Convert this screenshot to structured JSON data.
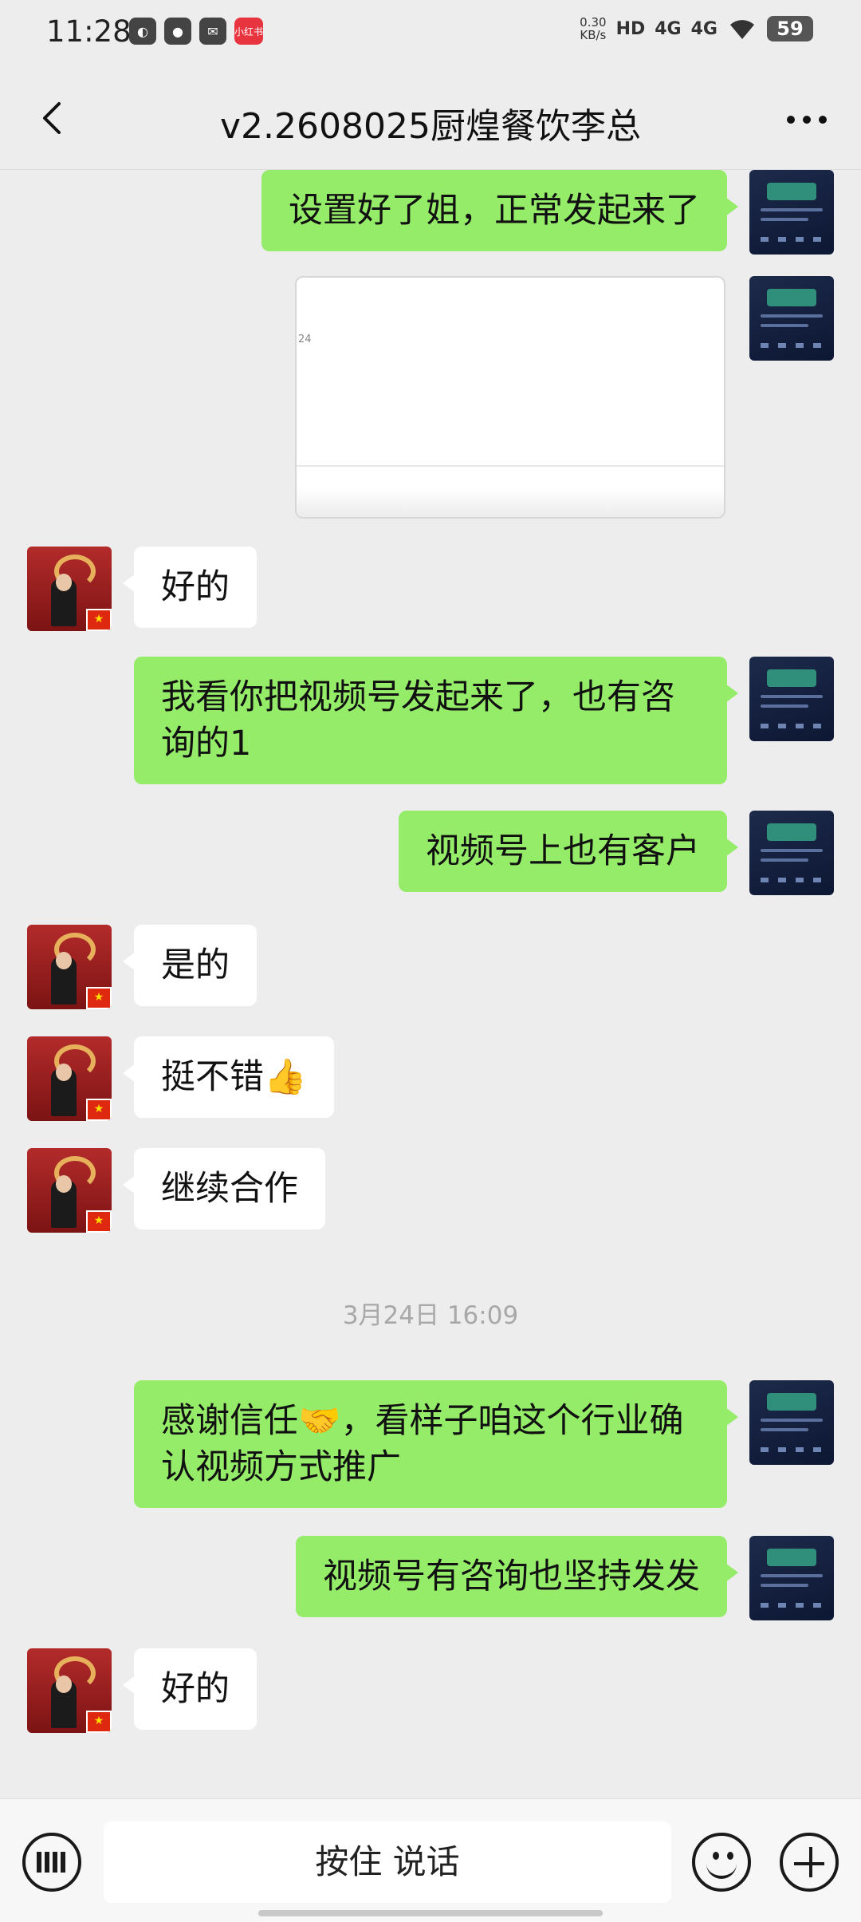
{
  "status_bar": {
    "time": "11:28",
    "net_speed_value": "0.30",
    "net_speed_unit": "KB/s",
    "hd_label": "HD",
    "signal_1": "4G",
    "signal_2": "4G",
    "battery": "59",
    "app_badge_label": "小红书"
  },
  "header": {
    "title": "v2.2608025厨煌餐饮李总"
  },
  "messages": [
    {
      "side": "right",
      "type": "text",
      "text": "设置好了姐，正常发起来了"
    },
    {
      "side": "right",
      "type": "image"
    },
    {
      "side": "left",
      "type": "text",
      "text": "好的"
    },
    {
      "side": "right",
      "type": "text",
      "text": "我看你把视频号发起来了，也有咨询的1"
    },
    {
      "side": "right",
      "type": "text",
      "text": "视频号上也有客户"
    },
    {
      "side": "left",
      "type": "text",
      "text": "是的"
    },
    {
      "side": "left",
      "type": "text",
      "text": "挺不错👍"
    },
    {
      "side": "left",
      "type": "text",
      "text": "继续合作"
    },
    {
      "type": "timestamp",
      "text": "3月24日 16:09"
    },
    {
      "side": "right",
      "type": "text",
      "text": "感谢信任🤝，看样子咱这个行业确认视频方式推广"
    },
    {
      "side": "right",
      "type": "text",
      "text": "视频号有咨询也坚持发发"
    },
    {
      "side": "left",
      "type": "text",
      "text": "好的"
    }
  ],
  "input_bar": {
    "voice_label": "按住 说话"
  },
  "colors": {
    "background": "#ededed",
    "sent_bubble": "#95ec69",
    "received_bubble": "#ffffff"
  }
}
